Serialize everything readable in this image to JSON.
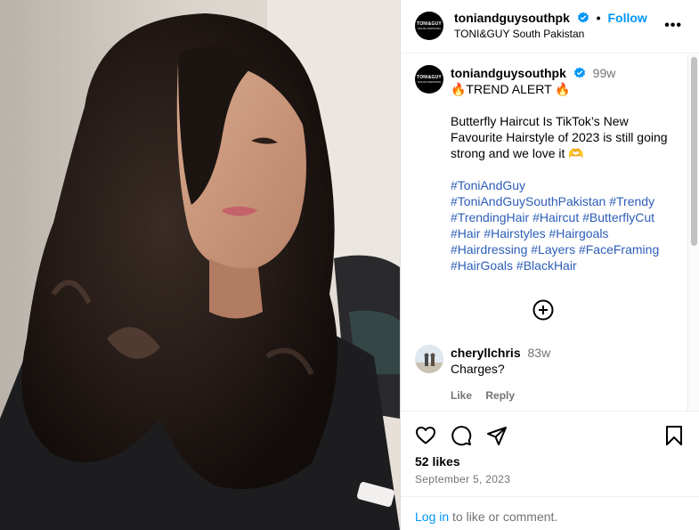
{
  "header": {
    "username": "toniandguysouthpk",
    "separator": "•",
    "follow_label": "Follow",
    "subtitle": "TONI&GUY South Pakistan",
    "more_label": "•••"
  },
  "logo": {
    "main": "TONI&GUY",
    "sub": "SOUTH PAKISTAN"
  },
  "caption": {
    "username": "toniandguysouthpk",
    "time": "99w",
    "line1": "🔥TREND ALERT 🔥",
    "line2": "Butterfly Haircut Is TikTok’s New Favourite Hairstyle of 2023 is still going strong and we love it 🫶",
    "hashtags": [
      "#ToniAndGuy",
      "#ToniAndGuySouthPakistan",
      "#Trendy",
      "#TrendingHair",
      "#Haircut",
      "#ButterflyCut",
      "#Hair",
      "#Hairstyles",
      "#Hairgoals",
      "#Hairdressing",
      "#Layers",
      "#FaceFraming",
      "#HairGoals",
      "#BlackHair"
    ]
  },
  "comment": {
    "username": "cheryllchris",
    "time": "83w",
    "text": "Charges?",
    "like_label": "Like",
    "reply_label": "Reply"
  },
  "footer": {
    "likes": "52 likes",
    "date": "September 5, 2023",
    "login_link": "Log in",
    "login_rest": " to like or comment."
  },
  "icons": {
    "like": "heart-icon",
    "comment": "comment-icon",
    "share": "share-icon",
    "save": "bookmark-icon",
    "add": "add-circle-icon",
    "verified": "verified-badge-icon",
    "more": "more-options-icon"
  },
  "colors": {
    "accent": "#0095f6",
    "hashtag": "#2c5db7",
    "muted": "#737373",
    "verified": "#0095f6"
  }
}
